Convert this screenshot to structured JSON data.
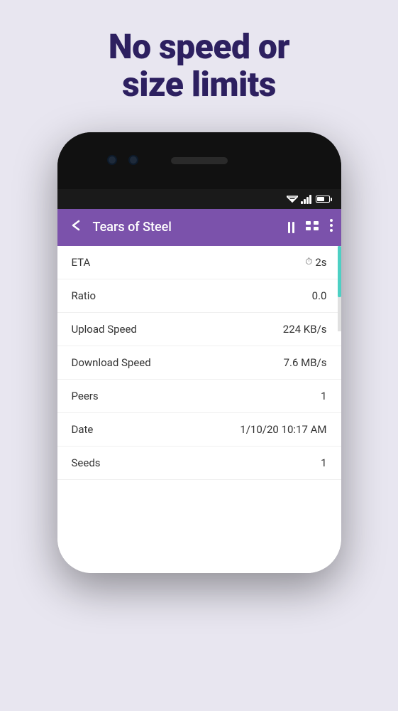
{
  "background_color": "#e8e6f0",
  "headline": {
    "line1": "No speed or",
    "line2": "size limits"
  },
  "phone": {
    "status_bar": {
      "wifi": "▼▲",
      "battery": ""
    },
    "app_header": {
      "title": "Tears of Steel",
      "back_icon": "←",
      "pause_icon": "⏸",
      "menu_icon": "⋮"
    },
    "info_rows": [
      {
        "label": "ETA",
        "value": "2s",
        "has_clock": true
      },
      {
        "label": "Ratio",
        "value": "0.0",
        "has_clock": false
      },
      {
        "label": "Upload Speed",
        "value": "224 KB/s",
        "has_clock": false
      },
      {
        "label": "Download Speed",
        "value": "7.6 MB/s",
        "has_clock": false
      },
      {
        "label": "Peers",
        "value": "1",
        "has_clock": false
      },
      {
        "label": "Date",
        "value": "1/10/20 10:17 AM",
        "has_clock": false
      },
      {
        "label": "Seeds",
        "value": "1",
        "has_clock": false
      }
    ]
  }
}
